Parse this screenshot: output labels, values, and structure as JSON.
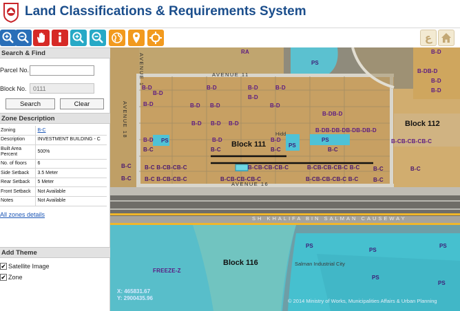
{
  "app": {
    "title": "Land Classifications & Requirements System"
  },
  "toolbar": {
    "tools": [
      {
        "name": "zoom-in-icon",
        "color": "#2a6fb8"
      },
      {
        "name": "zoom-out-icon",
        "color": "#2a6fb8"
      },
      {
        "name": "pan-hand-icon",
        "color": "#d62a26"
      },
      {
        "name": "info-icon",
        "color": "#d62a26"
      },
      {
        "name": "zoom-in-box-icon",
        "color": "#27a9c6"
      },
      {
        "name": "zoom-out-box-icon",
        "color": "#27a9c6"
      },
      {
        "name": "globe-icon",
        "color": "#f29a1e"
      },
      {
        "name": "location-pin-icon",
        "color": "#f29a1e"
      },
      {
        "name": "crosshair-icon",
        "color": "#f29a1e"
      }
    ],
    "language_glyph": "ع",
    "home_icon": "home-icon"
  },
  "search": {
    "header": "Search & Find",
    "parcel_label": "Parcel No.",
    "parcel_value": "",
    "block_label": "Block No.",
    "block_placeholder": "0111",
    "search_button": "Search",
    "clear_button": "Clear"
  },
  "zone": {
    "header": "Zone Description",
    "rows": [
      {
        "key": "Zoning",
        "value": "B-C"
      },
      {
        "key": "Description",
        "value": "INVESTMENT BUILDING - C"
      },
      {
        "key": "Built Area Percent",
        "value": "500%"
      },
      {
        "key": "No. of floors",
        "value": "6"
      },
      {
        "key": "Side Setback",
        "value": "3.5 Meter"
      },
      {
        "key": "Rear Setback",
        "value": "5 Meter"
      },
      {
        "key": "Front Setback",
        "value": "Not Available"
      },
      {
        "key": "Notes",
        "value": "Not Available"
      }
    ],
    "all_zones_link": "All zones details"
  },
  "theme": {
    "header": "Add Theme",
    "options": [
      {
        "label": "Satellite Image",
        "checked": true
      },
      {
        "label": "Zone",
        "checked": true
      }
    ]
  },
  "map": {
    "blocks": {
      "b111": "Block 111",
      "b112": "Block 112",
      "b116": "Block 116"
    },
    "streets": {
      "avenue11": "AVENUE 11",
      "avenue16": "AVENUE 16",
      "avenue18": "AVENUE 18",
      "avenue1": "AVENUE 1",
      "causeway": "SH KHALIFA BIN SALMAN CAUSEWAY",
      "hidd": "Hidd",
      "industrial": "Salman Industrial City"
    },
    "zone_labels": {
      "ra": "RA",
      "ps": "PS",
      "bd": "B-D",
      "bc": "B-C",
      "freeze": "FREEZE-Z",
      "row_bd_long": "B-DB-DB-DB-DB-DB-D",
      "row_bc_long": "B-CB-CB-CB-C",
      "row_bd_right": "B-DB-D",
      "row_bc_mid": "B-C B-CB-CB-C",
      "row_bc_low": "B-CB-CB-CB-C B-C"
    },
    "coord_x": "X: 465831.67",
    "coord_y": "Y: 2900435.96",
    "copyright": "© 2014 Ministry of Works, Municipalities Affairs & Urban Planning"
  }
}
